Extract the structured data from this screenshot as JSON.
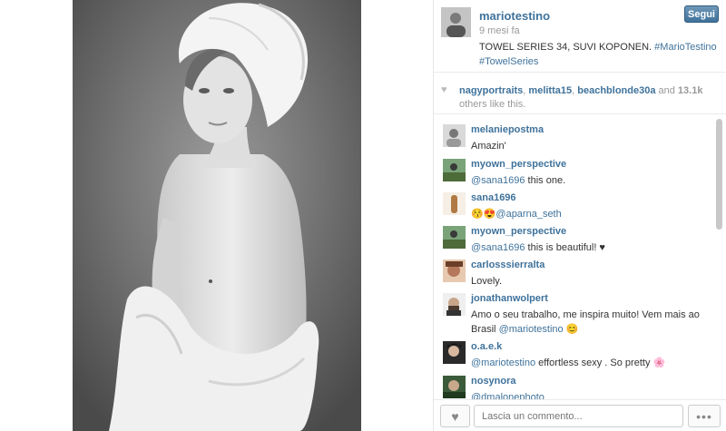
{
  "post": {
    "username": "mariotestino",
    "timestamp": "9 mesi fa",
    "caption_text": "TOWEL SERIES 34, SUVI KOPONEN. ",
    "caption_tag1": "#MarioTestino",
    "caption_tag2": "#TowelSeries",
    "follow_label": "Segui"
  },
  "likes": {
    "user1": "nagyportraits",
    "sep1": ", ",
    "user2": "melitta15",
    "sep2": ", ",
    "user3": "beachblonde30a",
    "and_text": " and ",
    "count": "13.1k",
    "suffix": " others like this."
  },
  "comments": [
    {
      "user": "melaniepostma",
      "text": "Amazin'"
    },
    {
      "user": "myown_perspective",
      "mention": "@sana1696",
      "text": " this one."
    },
    {
      "user": "sana1696",
      "emoji": "😚😍",
      "mention": "@aparna_seth",
      "text": ""
    },
    {
      "user": "myown_perspective",
      "mention": "@sana1696",
      "text": " this is beautiful! ♥"
    },
    {
      "user": "carlosssierralta",
      "text": "Lovely."
    },
    {
      "user": "jonathanwolpert",
      "text": "Amo o seu trabalho, me inspira muito! Vem mais ao Brasil ",
      "mention": "@mariotestino",
      "emoji": " 😊"
    },
    {
      "user": "o.a.e.k",
      "mention": "@mariotestino",
      "text": " effortless sexy . So pretty 🌸"
    },
    {
      "user": "nosynora",
      "mention": "@dmalonephoto",
      "text": ""
    }
  ],
  "footer": {
    "comment_placeholder": "Lascia un commento...",
    "more_label": "•••"
  },
  "colors": {
    "link": "#3f729b",
    "button": "#3f729b"
  },
  "icons": {
    "like": "heart-icon",
    "more": "ellipsis-icon"
  }
}
